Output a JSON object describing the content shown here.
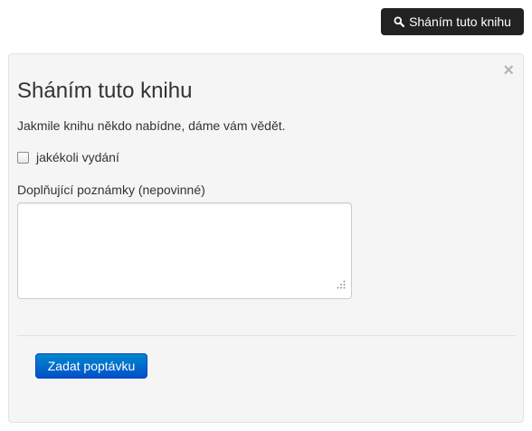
{
  "header": {
    "button_label": "Sháním tuto knihu",
    "button_icon": "search-icon"
  },
  "panel": {
    "close_label": "×",
    "title": "Sháním tuto knihu",
    "lead": "Jakmile knihu někdo nabídne, dáme vám vědět.",
    "checkbox_label": "jakékoli vydání",
    "checkbox_checked": false,
    "notes_label": "Doplňující poznámky (nepovinné)",
    "notes_value": "",
    "submit_label": "Zadat poptávku"
  },
  "colors": {
    "top_button_bg": "#222222",
    "panel_bg": "#f5f5f5",
    "submit_bg": "#0069cc"
  }
}
